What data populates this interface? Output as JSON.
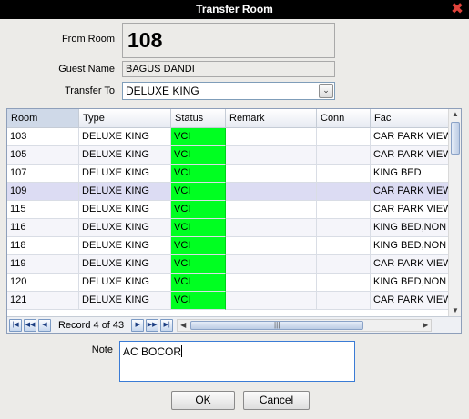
{
  "window": {
    "title": "Transfer Room"
  },
  "form": {
    "from_room_label": "From Room",
    "from_room_value": "108",
    "guest_name_label": "Guest Name",
    "guest_name_value": "BAGUS DANDI",
    "transfer_to_label": "Transfer To",
    "transfer_to_value": "DELUXE KING"
  },
  "grid": {
    "columns": [
      "Room",
      "Type",
      "Status",
      "Remark",
      "Conn",
      "Fac"
    ],
    "rows": [
      {
        "room": "103",
        "type": "DELUXE KING",
        "status": "VCI",
        "remark": "",
        "conn": "",
        "fac": "CAR PARK VIEW"
      },
      {
        "room": "105",
        "type": "DELUXE KING",
        "status": "VCI",
        "remark": "",
        "conn": "",
        "fac": "CAR PARK VIEW"
      },
      {
        "room": "107",
        "type": "DELUXE KING",
        "status": "VCI",
        "remark": "",
        "conn": "",
        "fac": "KING BED"
      },
      {
        "room": "109",
        "type": "DELUXE KING",
        "status": "VCI",
        "remark": "",
        "conn": "",
        "fac": "CAR PARK VIEW"
      },
      {
        "room": "115",
        "type": "DELUXE KING",
        "status": "VCI",
        "remark": "",
        "conn": "",
        "fac": "CAR PARK VIEW"
      },
      {
        "room": "116",
        "type": "DELUXE KING",
        "status": "VCI",
        "remark": "",
        "conn": "",
        "fac": "KING BED,NON S"
      },
      {
        "room": "118",
        "type": "DELUXE KING",
        "status": "VCI",
        "remark": "",
        "conn": "",
        "fac": "KING BED,NON S"
      },
      {
        "room": "119",
        "type": "DELUXE KING",
        "status": "VCI",
        "remark": "",
        "conn": "",
        "fac": "CAR PARK VIEW"
      },
      {
        "room": "120",
        "type": "DELUXE KING",
        "status": "VCI",
        "remark": "",
        "conn": "",
        "fac": "KING BED,NON S"
      },
      {
        "room": "121",
        "type": "DELUXE KING",
        "status": "VCI",
        "remark": "",
        "conn": "",
        "fac": "CAR PARK VIEW"
      }
    ],
    "selected_row_index": 3,
    "status_color": "#00ff21"
  },
  "navigator": {
    "record_text": "Record 4 of 43"
  },
  "note": {
    "label": "Note",
    "value": "AC BOCOR"
  },
  "buttons": {
    "ok": "OK",
    "cancel": "Cancel"
  },
  "icons": {
    "close": "close-icon",
    "dropdown": "chevron-down-icon",
    "first": "first-record-icon",
    "prev_page": "previous-page-icon",
    "prev": "previous-record-icon",
    "next": "next-record-icon",
    "next_page": "next-page-icon",
    "last": "last-record-icon"
  }
}
